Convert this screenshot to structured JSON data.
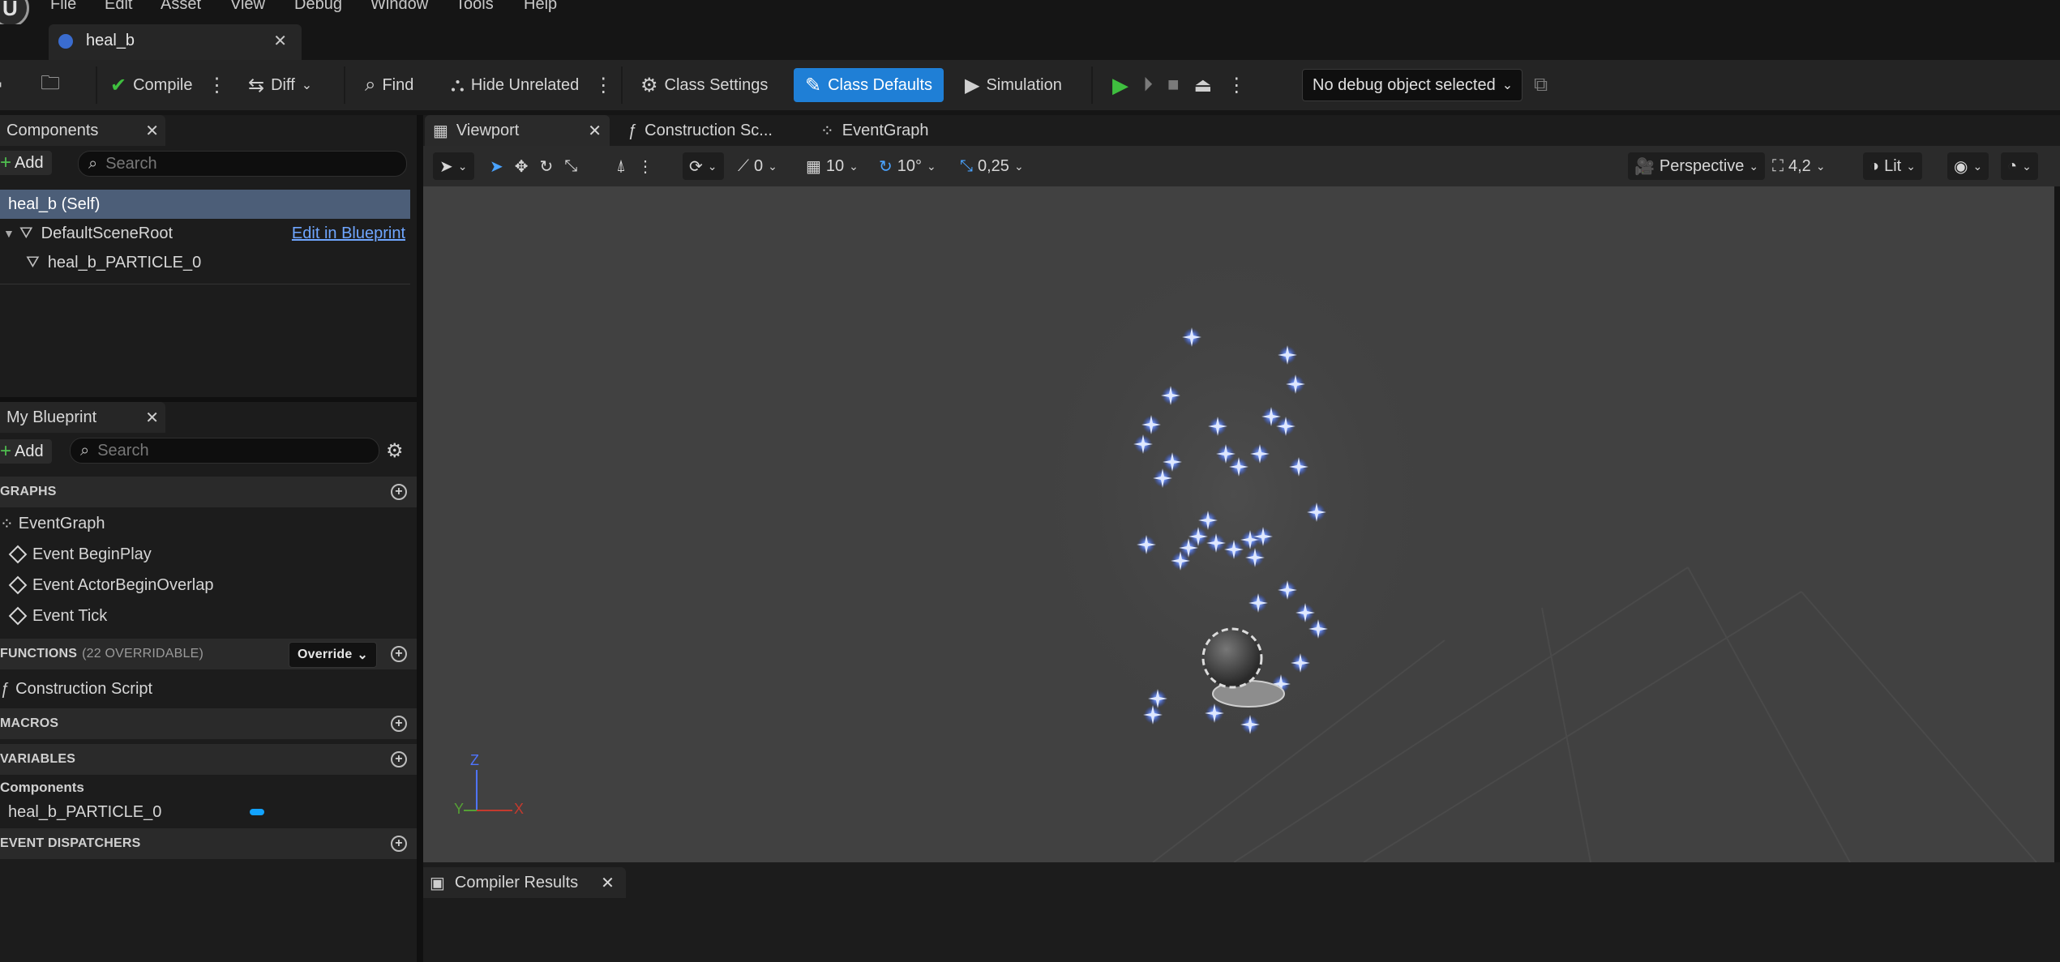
{
  "menu": [
    "File",
    "Edit",
    "Asset",
    "View",
    "Debug",
    "Window",
    "Tools",
    "Help"
  ],
  "document_tab": {
    "title": "heal_b"
  },
  "toolbar": {
    "compile": "Compile",
    "diff": "Diff",
    "find": "Find",
    "hide_unrelated": "Hide Unrelated",
    "class_settings": "Class Settings",
    "class_defaults": "Class Defaults",
    "simulation": "Simulation",
    "debug_object": "No debug object selected"
  },
  "components_panel": {
    "title": "Components",
    "add": "Add",
    "search_placeholder": "Search",
    "self": "heal_b (Self)",
    "root": "DefaultSceneRoot",
    "edit_link": "Edit in Blueprint",
    "child": "heal_b_PARTICLE_0"
  },
  "my_blueprint": {
    "title": "My Blueprint",
    "add": "Add",
    "search_placeholder": "Search",
    "graphs_header": "GRAPHS",
    "event_graph": "EventGraph",
    "events": [
      "Event BeginPlay",
      "Event ActorBeginOverlap",
      "Event Tick"
    ],
    "functions_header": "FUNCTIONS",
    "functions_count": "(22 OVERRIDABLE)",
    "override": "Override",
    "construction_script": "Construction Script",
    "macros_header": "MACROS",
    "variables_header": "VARIABLES",
    "components_category": "Components",
    "variable_item": "heal_b_PARTICLE_0",
    "dispatchers_header": "EVENT DISPATCHERS"
  },
  "editor_tabs": [
    "Viewport",
    "Construction Sc...",
    "EventGraph"
  ],
  "viewport_toolbar": {
    "rotation_snap_value": "0",
    "grid_value": "10",
    "angle_value": "10°",
    "scale_value": "0,25",
    "perspective": "Perspective",
    "speed": "4,2",
    "lit": "Lit"
  },
  "axis_gizmo": {
    "z": "Z",
    "y": "Y",
    "x": "X"
  },
  "bottom_panel": {
    "title": "Compiler Results"
  },
  "colors": {
    "accent": "#1f7fd6",
    "play": "#3fbf3f",
    "selection": "#4c5e78",
    "particle": "#4a78ff"
  }
}
